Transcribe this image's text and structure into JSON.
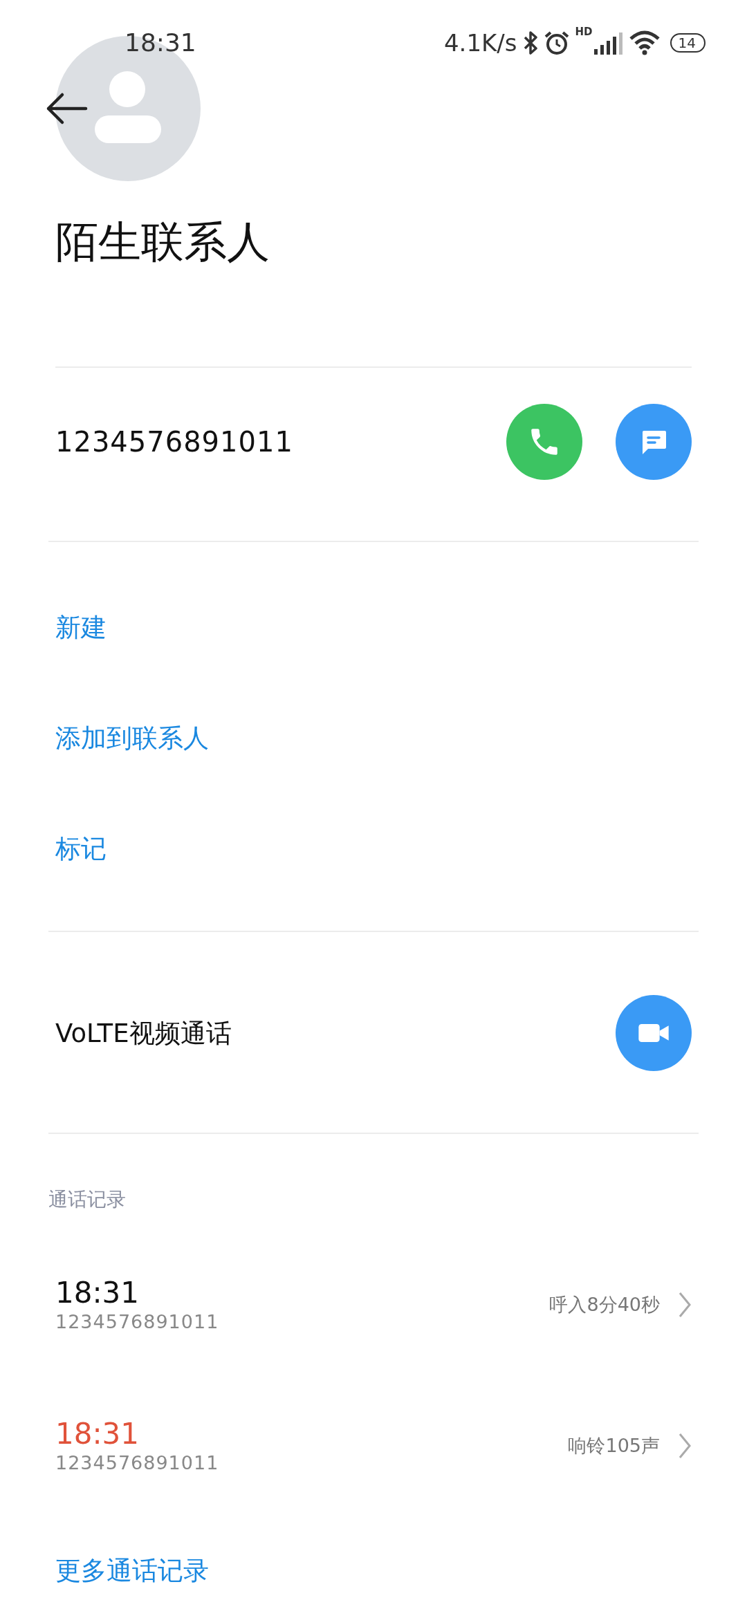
{
  "status_bar": {
    "time": "18:31",
    "net_speed": "4.1K/s",
    "signal_label": "HD",
    "battery": "14"
  },
  "contact": {
    "name": "陌生联系人",
    "number": "1234576891011"
  },
  "actions": [
    {
      "label": "新建"
    },
    {
      "label": "添加到联系人"
    },
    {
      "label": "标记"
    }
  ],
  "video_call": {
    "label": "VoLTE视频通话"
  },
  "call_log": {
    "heading": "通话记录",
    "entries": [
      {
        "time": "18:31",
        "number": "1234576891011",
        "detail": "呼入8分40秒",
        "missed": false
      },
      {
        "time": "18:31",
        "number": "1234576891011",
        "detail": "响铃105声",
        "missed": true
      }
    ],
    "more": "更多通话记录"
  }
}
